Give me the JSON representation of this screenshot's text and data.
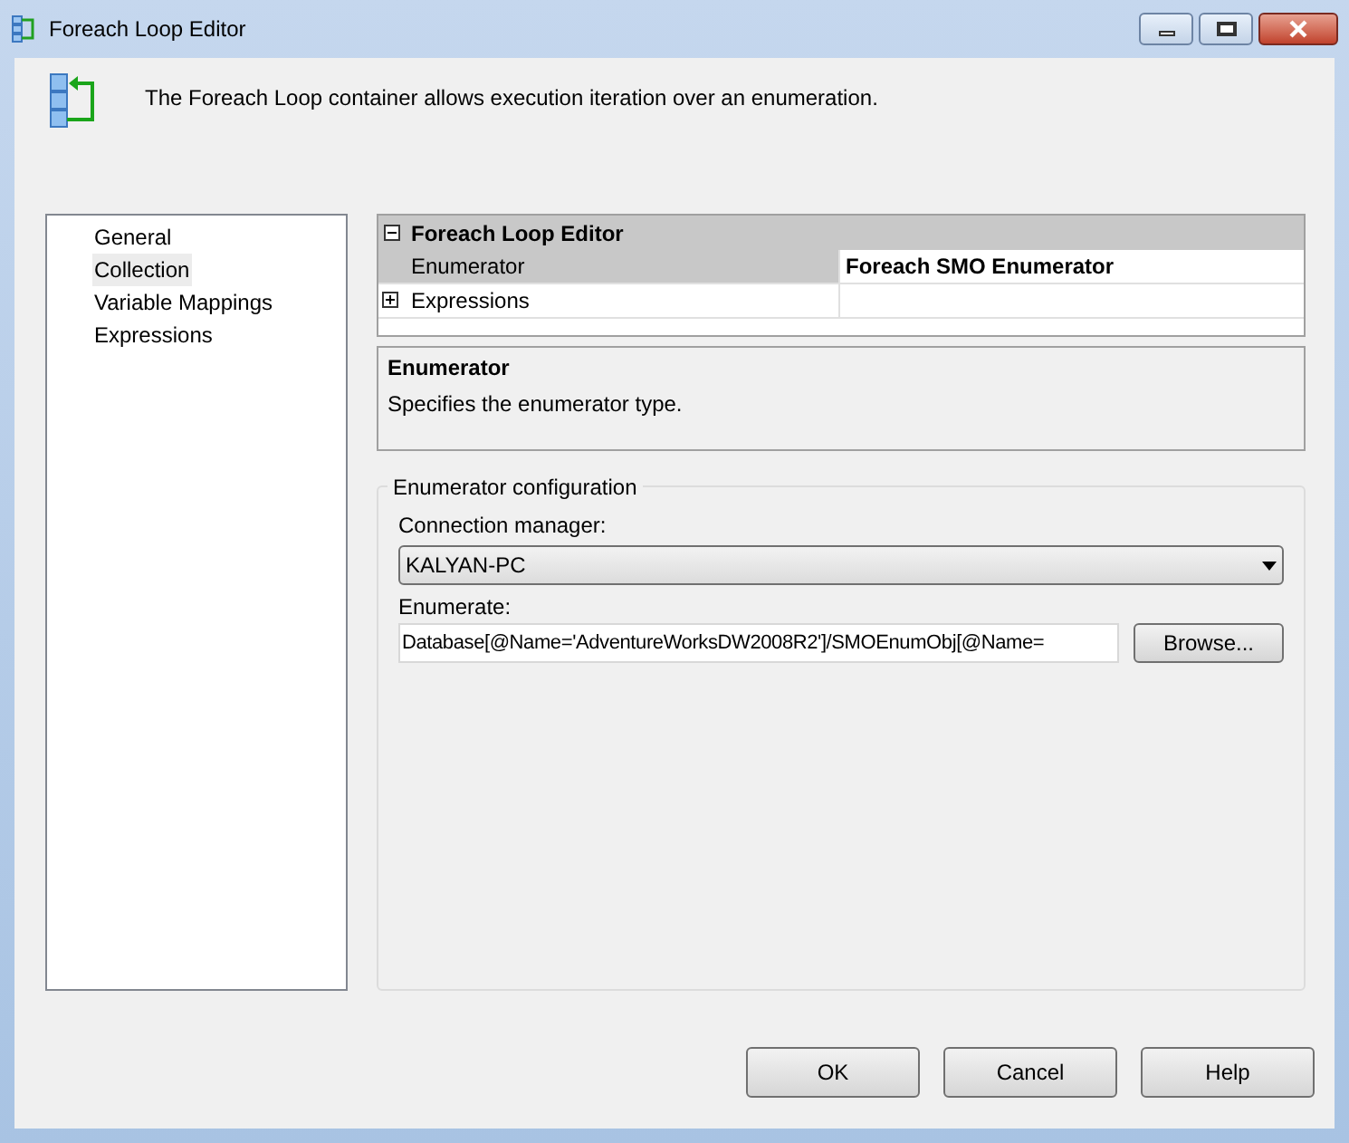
{
  "window": {
    "title": "Foreach Loop Editor"
  },
  "header": {
    "text": "The Foreach Loop container allows execution iteration over an enumeration."
  },
  "nav": {
    "items": [
      {
        "label": "General",
        "selected": false
      },
      {
        "label": "Collection",
        "selected": true
      },
      {
        "label": "Variable Mappings",
        "selected": false
      },
      {
        "label": "Expressions",
        "selected": false
      }
    ]
  },
  "property_grid": {
    "category": {
      "label": "Foreach Loop Editor",
      "expanded": true
    },
    "rows": [
      {
        "kind": "property",
        "name": "Enumerator",
        "value": "Foreach SMO Enumerator",
        "selected": true
      },
      {
        "kind": "group",
        "name": "Expressions",
        "expanded": false,
        "selected": false
      }
    ]
  },
  "description": {
    "title": "Enumerator",
    "text": "Specifies the enumerator type."
  },
  "configuration": {
    "title": "Enumerator configuration",
    "connection_manager": {
      "label": "Connection manager:",
      "value": "KALYAN-PC"
    },
    "enumerate": {
      "label": "Enumerate:",
      "value": "Database[@Name='AdventureWorksDW2008R2']/SMOEnumObj[@Name="
    },
    "browse_button": "Browse..."
  },
  "buttons": [
    "OK",
    "Cancel",
    "Help"
  ]
}
